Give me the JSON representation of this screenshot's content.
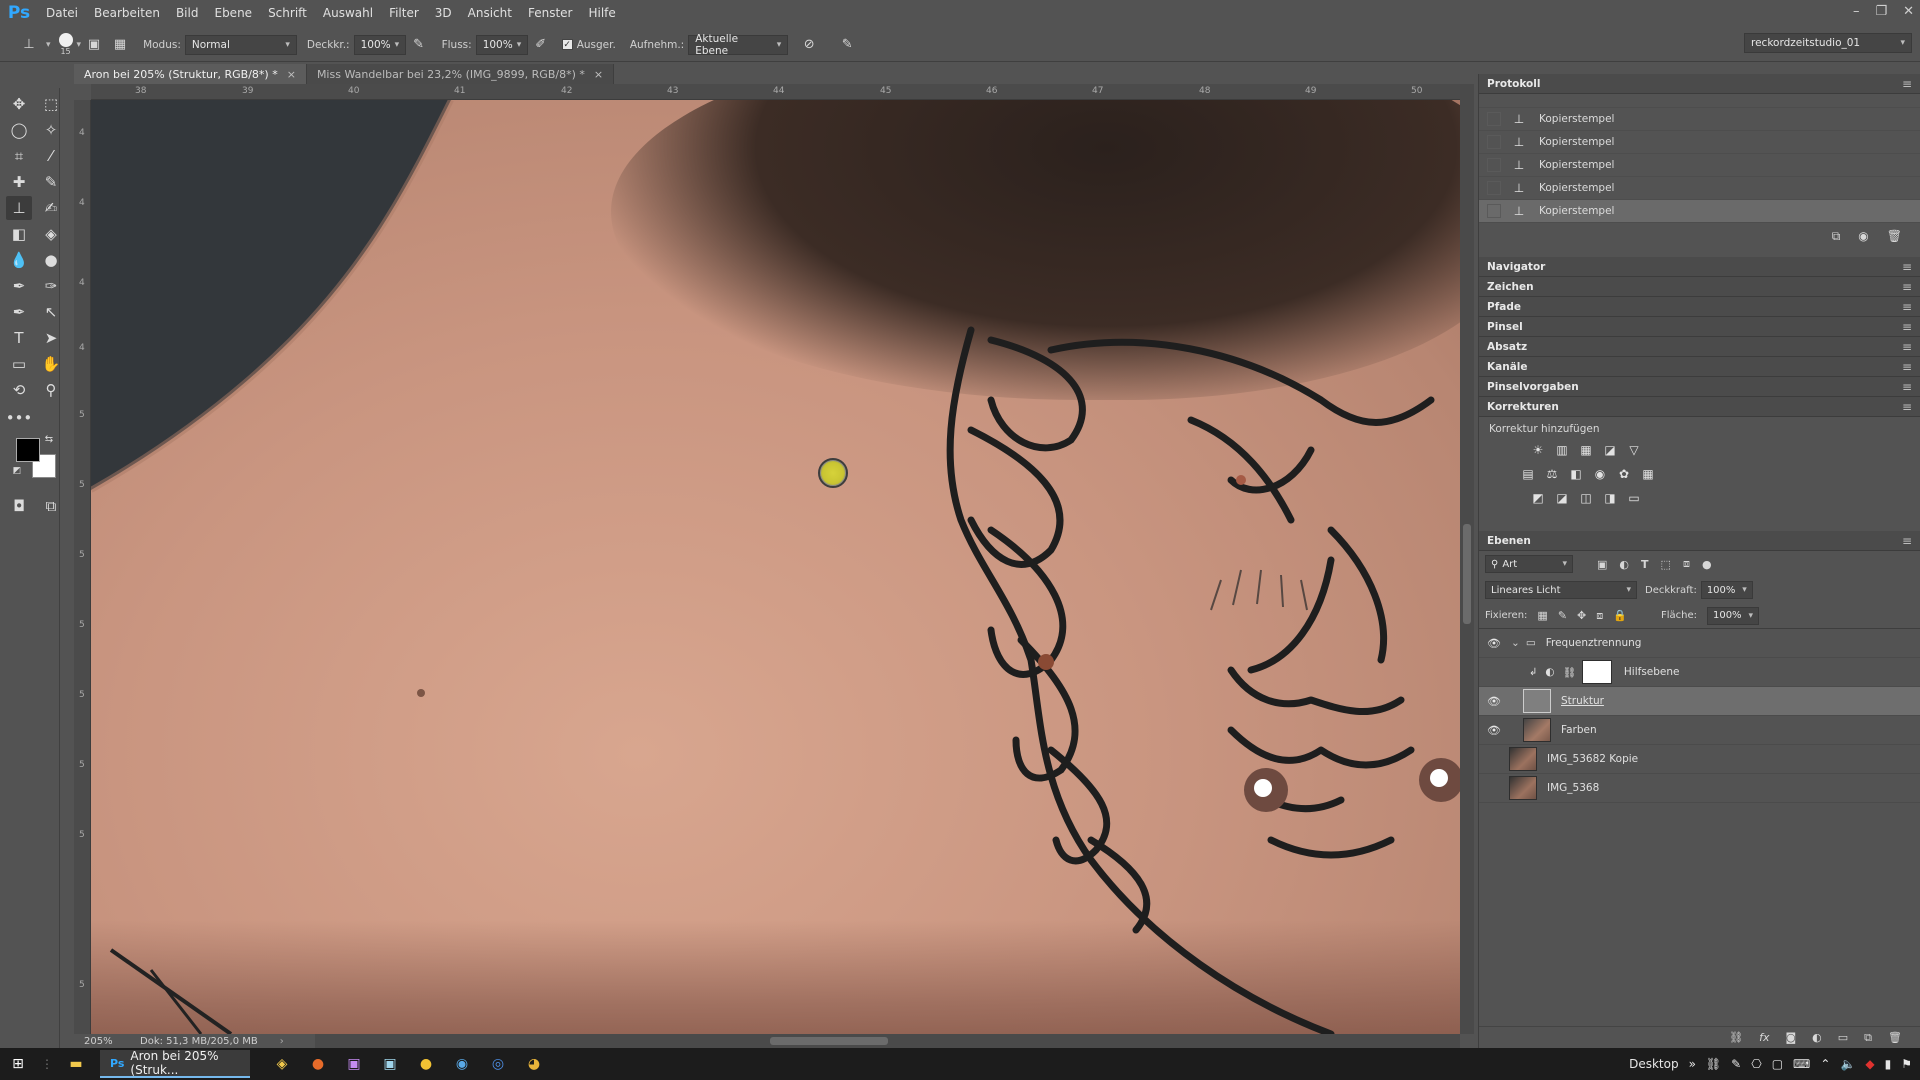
{
  "app": {
    "logo": "Ps",
    "menu": [
      "Datei",
      "Bearbeiten",
      "Bild",
      "Ebene",
      "Schrift",
      "Auswahl",
      "Filter",
      "3D",
      "Ansicht",
      "Fenster",
      "Hilfe"
    ],
    "window_controls": [
      "–",
      "❐",
      "✕"
    ]
  },
  "options": {
    "brush_size": "15",
    "modus_label": "Modus:",
    "modus_value": "Normal",
    "deckkraft_label": "Deckkr.:",
    "deckkraft_value": "100%",
    "fluss_label": "Fluss:",
    "fluss_value": "100%",
    "ausger_label": "Ausger.",
    "aufnehm_label": "Aufnehm.:",
    "aufnehm_value": "Aktuelle Ebene",
    "workspace": "reckordzeitstudio_01"
  },
  "tabs": [
    {
      "label": "Aron bei 205% (Struktur, RGB/8*) *"
    },
    {
      "label": "Miss Wandelbar bei 23,2% (IMG_9899, RGB/8*) *"
    }
  ],
  "rulers": {
    "h": [
      "38",
      "39",
      "40",
      "41",
      "42",
      "43",
      "44",
      "45",
      "46",
      "47",
      "48",
      "49",
      "50"
    ],
    "v": [
      "4",
      "4",
      "4",
      "4",
      "5",
      "5",
      "5",
      "5",
      "5",
      "5",
      "5",
      "5"
    ]
  },
  "status": {
    "zoom": "205%",
    "doc": "Dok: 51,3 MB/205,0 MB"
  },
  "history": {
    "title": "Protokoll",
    "items": [
      "Kopierstempel",
      "Kopierstempel",
      "Kopierstempel",
      "Kopierstempel",
      "Kopierstempel"
    ]
  },
  "collapsed_panels": [
    "Navigator",
    "Zeichen",
    "Pfade",
    "Pinsel",
    "Absatz",
    "Kanäle",
    "Pinselvorgaben"
  ],
  "korrekturen": {
    "title": "Korrekturen",
    "subtitle": "Korrektur hinzufügen"
  },
  "layers": {
    "title": "Ebenen",
    "filter_value": "Art",
    "blend_mode": "Lineares Licht",
    "deckkraft_label": "Deckkraft:",
    "deckkraft_value": "100%",
    "fixieren_label": "Fixieren:",
    "flaeche_label": "Fläche:",
    "flaeche_value": "100%",
    "rows": [
      {
        "name": "Frequenztrennung",
        "visible": true,
        "type": "group"
      },
      {
        "name": "Hilfsebene",
        "visible": false,
        "type": "adjustment"
      },
      {
        "name": "Struktur",
        "visible": true,
        "type": "gray"
      },
      {
        "name": "Farben",
        "visible": true,
        "type": "photo"
      },
      {
        "name": "IMG_53682 Kopie",
        "visible": false,
        "type": "photo"
      },
      {
        "name": "IMG_5368",
        "visible": false,
        "type": "photo"
      }
    ]
  },
  "taskbar": {
    "active_app": "Aron bei 205% (Struk...",
    "desktop_label": "Desktop"
  },
  "colors": {
    "accent": "#31a8ff",
    "panel_bg": "#535353",
    "selected_row": "#6e6e6e",
    "tattoo_ink": "#1e1e1e"
  }
}
